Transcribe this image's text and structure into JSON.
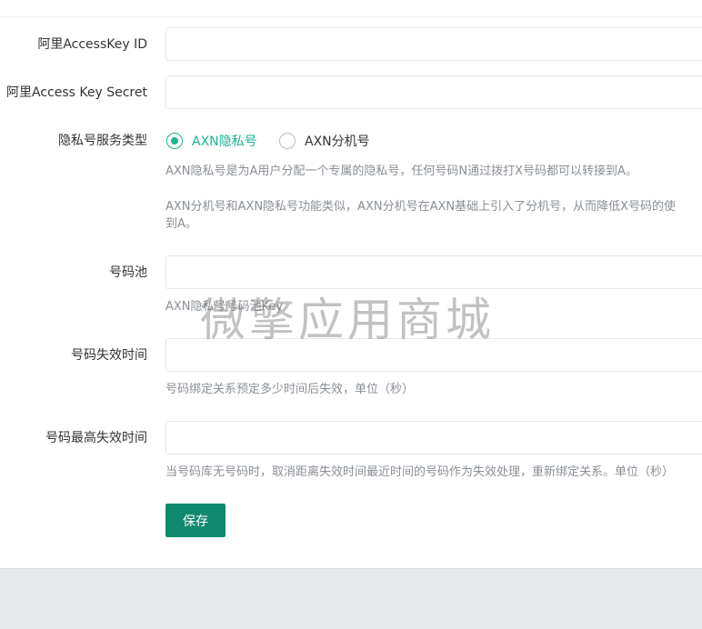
{
  "form": {
    "access_key_id": {
      "label": "阿里AccessKey ID",
      "value": ""
    },
    "access_key_secret": {
      "label": "阿里Access Key Secret",
      "value": ""
    },
    "service_type": {
      "label": "隐私号服务类型",
      "options": [
        {
          "label": "AXN隐私号",
          "checked": true
        },
        {
          "label": "AXN分机号",
          "checked": false
        }
      ],
      "help_1": "AXN隐私号是为A用户分配一个专属的隐私号，任何号码N通过拨打X号码都可以转接到A。",
      "help_2_line1": "AXN分机号和AXN隐私号功能类似，AXN分机号在AXN基础上引入了分机号，从而降低X号码的使",
      "help_2_line2": "到A。"
    },
    "number_pool": {
      "label": "号码池",
      "value": "",
      "help": "AXN隐私号号码池Key"
    },
    "expire_time": {
      "label": "号码失效时间",
      "value": "",
      "help": "号码绑定关系预定多少时间后失效，单位（秒）"
    },
    "max_expire_time": {
      "label": "号码最高失效时间",
      "value": "",
      "help": "当号码库无号码时，取消距离失效时间最近时间的号码作为失效处理，重新绑定关系。单位（秒）"
    },
    "save_label": "保存"
  },
  "watermark": "微擎应用商城",
  "colors": {
    "accent": "#1ab394",
    "button": "#0f8a6e",
    "page_background": "#e6e8eb"
  }
}
